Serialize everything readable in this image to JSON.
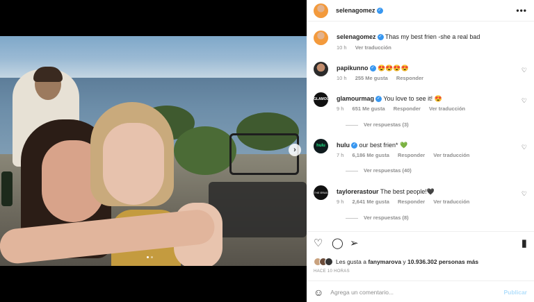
{
  "post": {
    "author": "selenagomez",
    "next_icon": "chevron-right-icon",
    "more_icon": "more-horizontal-icon"
  },
  "comments": [
    {
      "user": "selenagomez",
      "verified": true,
      "text": "Thas my best frien -she a real bad",
      "time": "10 h",
      "likes": "",
      "reply": "",
      "translate": "Ver traducción",
      "replies": ""
    },
    {
      "user": "papikunno",
      "verified": true,
      "text": "😍😍😍😍",
      "time": "10 h",
      "likes": "255 Me gusta",
      "reply": "Responder",
      "translate": "",
      "replies": ""
    },
    {
      "user": "glamourmag",
      "verified": true,
      "text": "You love to see it! 😍",
      "time": "9 h",
      "likes": "651 Me gusta",
      "reply": "Responder",
      "translate": "Ver traducción",
      "replies": "Ver respuestas (3)"
    },
    {
      "user": "hulu",
      "verified": true,
      "text": "our best frien* 💚",
      "time": "7 h",
      "likes": "6,186 Me gusta",
      "reply": "Responder",
      "translate": "Ver traducción",
      "replies": "Ver respuestas (40)"
    },
    {
      "user": "taylorerastour",
      "verified": false,
      "text": "The best people!🖤",
      "time": "9 h",
      "likes": "2,641 Me gusta",
      "reply": "Responder",
      "translate": "Ver traducción",
      "replies": "Ver respuestas (8)"
    }
  ],
  "actions": {
    "like_icon": "heart-icon",
    "comment_icon": "comment-icon",
    "share_icon": "share-icon",
    "save_icon": "bookmark-icon",
    "likes_prefix": "Les gusta a",
    "likes_user": "fanymarova",
    "likes_middle": "y",
    "likes_count": "10.936.302 personas más",
    "timestamp": "HACE 10 HORAS"
  },
  "comment_box": {
    "placeholder": "Agrega un comentario...",
    "publish_label": "Publicar",
    "emoji_icon": "emoji-icon"
  },
  "colors": {
    "accent": "#3897f0",
    "publish_disabled": "#b2dffc"
  }
}
